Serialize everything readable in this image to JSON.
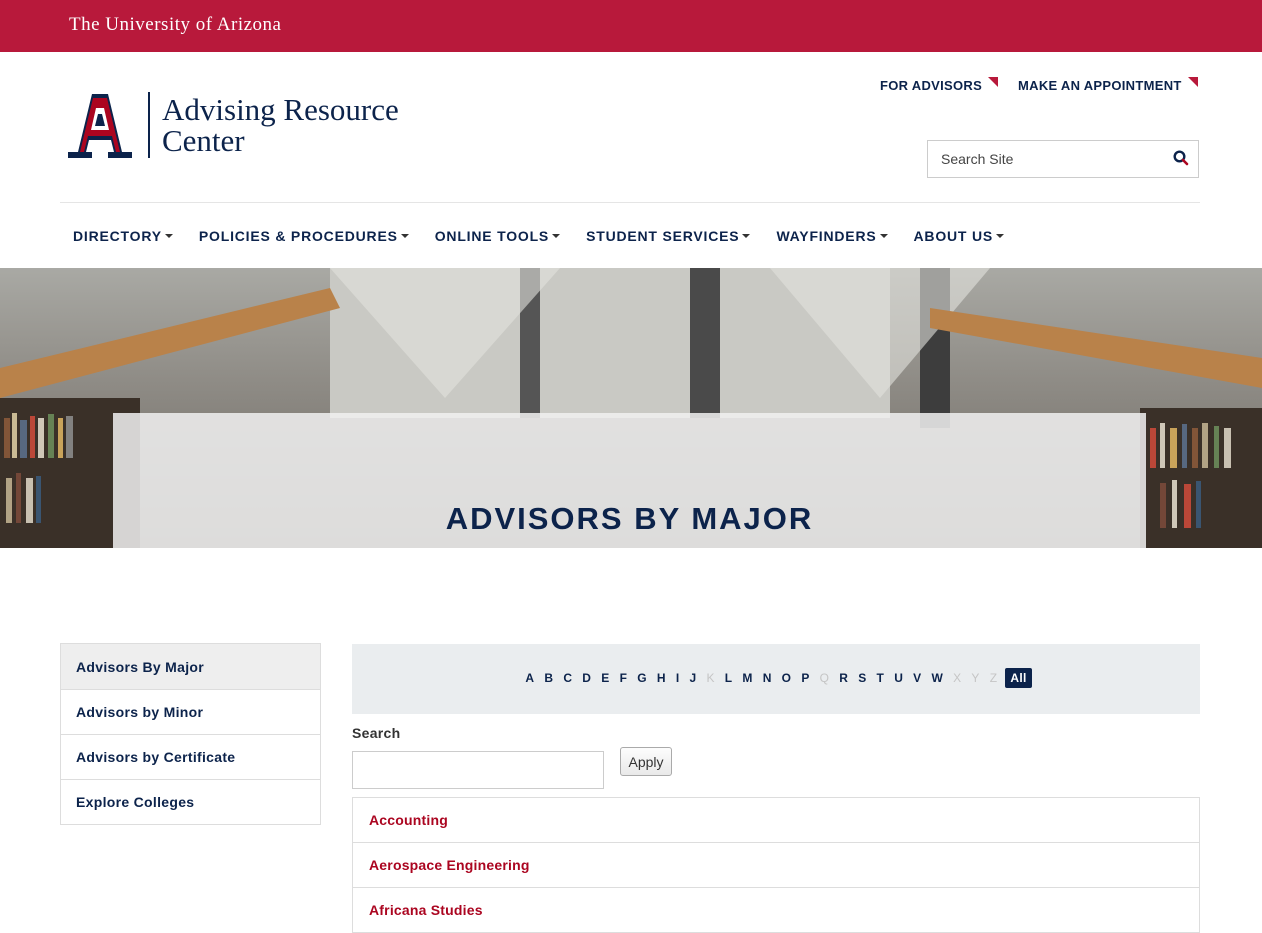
{
  "topbar": {
    "university": "The University of Arizona"
  },
  "logo": {
    "line1": "Advising Resource",
    "line2": "Center"
  },
  "utility": {
    "for_advisors": "FOR ADVISORS",
    "appointment": "MAKE AN APPOINTMENT"
  },
  "search": {
    "placeholder": "Search Site"
  },
  "nav": {
    "items": [
      "DIRECTORY",
      "POLICIES & PROCEDURES",
      "ONLINE TOOLS",
      "STUDENT SERVICES",
      "WAYFINDERS",
      "ABOUT US"
    ]
  },
  "hero": {
    "title": "ADVISORS BY MAJOR"
  },
  "sidebar": {
    "items": [
      "Advisors By Major",
      "Advisors by Minor",
      "Advisors by Certificate",
      "Explore Colleges"
    ]
  },
  "alpha": {
    "letters": [
      "A",
      "B",
      "C",
      "D",
      "E",
      "F",
      "G",
      "H",
      "I",
      "J",
      "K",
      "L",
      "M",
      "N",
      "O",
      "P",
      "Q",
      "R",
      "S",
      "T",
      "U",
      "V",
      "W",
      "X",
      "Y",
      "Z"
    ],
    "disabled": [
      "K",
      "Q",
      "X",
      "Y",
      "Z"
    ],
    "all_label": "All"
  },
  "filter": {
    "label": "Search",
    "apply": "Apply"
  },
  "majors": [
    "Accounting",
    "Aerospace Engineering",
    "Africana Studies"
  ],
  "colors": {
    "brand_red": "#b8193b",
    "navy": "#0c234b",
    "link_red": "#ab0520"
  }
}
